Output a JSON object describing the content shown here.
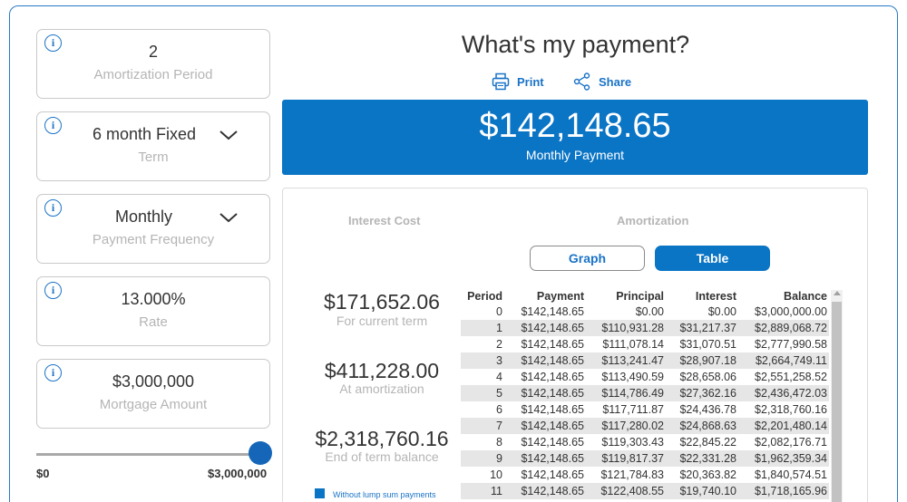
{
  "fields": {
    "amortization": {
      "value": "2",
      "label": "Amortization Period"
    },
    "term": {
      "value": "6 month Fixed",
      "label": "Term"
    },
    "frequency": {
      "value": "Monthly",
      "label": "Payment Frequency"
    },
    "rate": {
      "value": "13.000%",
      "label": "Rate"
    },
    "mortgage": {
      "value": "$3,000,000",
      "label": "Mortgage Amount"
    }
  },
  "info_glyph": "i",
  "slider": {
    "min_label": "$0",
    "max_label": "$3,000,000",
    "position": 1.0
  },
  "header": {
    "title": "What's my payment?",
    "print_label": "Print",
    "share_label": "Share"
  },
  "payment": {
    "amount": "$142,148.65",
    "caption": "Monthly Payment"
  },
  "results": {
    "interest_heading": "Interest Cost",
    "amortization_heading": "Amortization",
    "graph_label": "Graph",
    "table_label": "Table",
    "summaries": [
      {
        "amount": "$171,652.06",
        "caption": "For current term"
      },
      {
        "amount": "$411,228.00",
        "caption": "At amortization"
      },
      {
        "amount": "$2,318,760.16",
        "caption": "End of term balance"
      }
    ],
    "legend_label": "Without lump sum payments"
  },
  "table": {
    "columns": [
      "Period",
      "Payment",
      "Principal",
      "Interest",
      "Balance"
    ],
    "rows": [
      [
        "0",
        "$142,148.65",
        "$0.00",
        "$0.00",
        "$3,000,000.00"
      ],
      [
        "1",
        "$142,148.65",
        "$110,931.28",
        "$31,217.37",
        "$2,889,068.72"
      ],
      [
        "2",
        "$142,148.65",
        "$111,078.14",
        "$31,070.51",
        "$2,777,990.58"
      ],
      [
        "3",
        "$142,148.65",
        "$113,241.47",
        "$28,907.18",
        "$2,664,749.11"
      ],
      [
        "4",
        "$142,148.65",
        "$113,490.59",
        "$28,658.06",
        "$2,551,258.52"
      ],
      [
        "5",
        "$142,148.65",
        "$114,786.49",
        "$27,362.16",
        "$2,436,472.03"
      ],
      [
        "6",
        "$142,148.65",
        "$117,711.87",
        "$24,436.78",
        "$2,318,760.16"
      ],
      [
        "7",
        "$142,148.65",
        "$117,280.02",
        "$24,868.63",
        "$2,201,480.14"
      ],
      [
        "8",
        "$142,148.65",
        "$119,303.43",
        "$22,845.22",
        "$2,082,176.71"
      ],
      [
        "9",
        "$142,148.65",
        "$119,817.37",
        "$22,331.28",
        "$1,962,359.34"
      ],
      [
        "10",
        "$142,148.65",
        "$121,784.83",
        "$20,363.82",
        "$1,840,574.51"
      ],
      [
        "11",
        "$142,148.65",
        "$122,408.55",
        "$19,740.10",
        "$1,718,165.96"
      ]
    ]
  },
  "colors": {
    "brand_blue": "#0a74c5",
    "border": "#c9c9c9",
    "muted_text": "#b5b5b5",
    "row_shade": "#e6e6e6"
  }
}
